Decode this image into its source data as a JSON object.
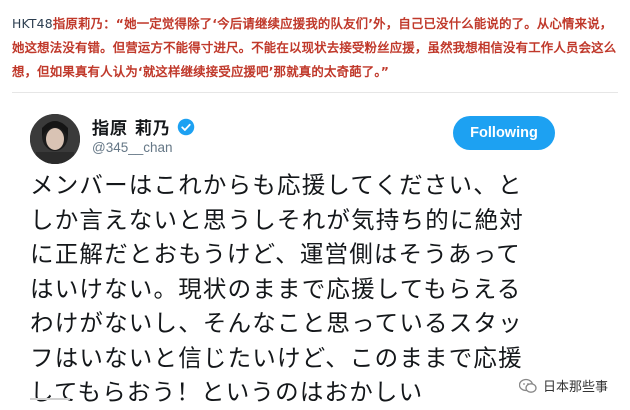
{
  "caption": {
    "tag": "HKT48",
    "speaker": "指原莉乃",
    "text": "：“她一定觉得除了‘今后请继续应援我的队友们’外，自己已没什么能说的了。从心情来说，她这想法没有错。但营运方不能得寸进尺。不能在以现状去接受粉丝应援，虽然我想相信没有工作人员会这么想，但如果真有人认为‘就这样继续接受应援吧’那就真的太奇葩了。”"
  },
  "profile": {
    "name": "指原 莉乃",
    "handle": "@345__chan",
    "follow_label": "Following"
  },
  "tweet": {
    "lines": [
      "メンバーはこれからも応援してください、と",
      "しか言えないと思うしそれが気持ち的に絶対",
      "に正解だとおもうけど、運営側はそうあって",
      "はいけない。現状のままで応援してもらえる",
      "わけがないし、そんなこと思っているスタッ",
      "フはいないと信じたいけど、このままで応援",
      "してもらおう！というのはおかしい"
    ]
  },
  "watermark": {
    "text": "日本那些事",
    "icon": "wechat-icon"
  },
  "colors": {
    "caption_red": "#c0392b",
    "follow_blue": "#1da1f2",
    "verified_blue": "#1da1f2",
    "text_dark": "#14171a",
    "handle_gray": "#657786"
  }
}
